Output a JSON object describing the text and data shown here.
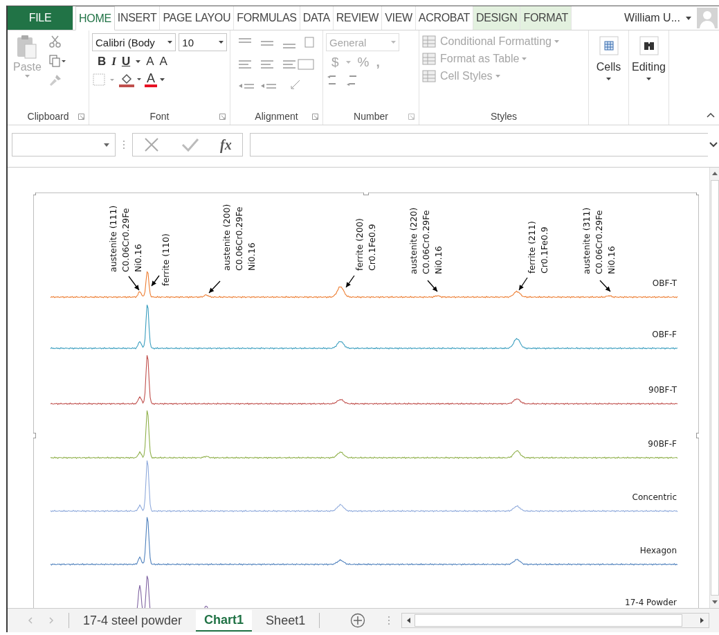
{
  "ribbon_tabs": [
    {
      "label": "FILE",
      "kind": "file",
      "selected": false
    },
    {
      "label": "HOME",
      "kind": "normal",
      "selected": true
    },
    {
      "label": "INSERT",
      "kind": "normal",
      "selected": false
    },
    {
      "label": "PAGE LAYOU",
      "kind": "normal",
      "selected": false
    },
    {
      "label": "FORMULAS",
      "kind": "normal",
      "selected": false
    },
    {
      "label": "DATA",
      "kind": "normal",
      "selected": false
    },
    {
      "label": "REVIEW",
      "kind": "normal",
      "selected": false
    },
    {
      "label": "VIEW",
      "kind": "normal",
      "selected": false
    },
    {
      "label": "ACROBAT",
      "kind": "normal",
      "selected": false
    },
    {
      "label": "DESIGN",
      "kind": "contextual",
      "selected": false
    },
    {
      "label": "FORMAT",
      "kind": "contextual",
      "selected": false
    }
  ],
  "user": {
    "name": "William U..."
  },
  "clipboard": {
    "label": "Clipboard",
    "paste": "Paste",
    "disabled": true
  },
  "font": {
    "label": "Font",
    "font_name": "Calibri (Body",
    "font_size": "10",
    "bold": "B",
    "italic": "I",
    "underline": "U",
    "grow": "A",
    "shrink": "A",
    "color_letter": "A"
  },
  "alignment": {
    "label": "Alignment"
  },
  "number": {
    "label": "Number",
    "format": "General",
    "currency": "$",
    "percent": "%",
    "comma": ",",
    "disabled": true
  },
  "styles": {
    "label": "Styles",
    "disabled": true,
    "items": [
      {
        "label": "Conditional Formatting"
      },
      {
        "label": "Format as Table"
      },
      {
        "label": "Cell Styles"
      }
    ]
  },
  "cells": {
    "label": "Cells"
  },
  "editing": {
    "label": "Editing"
  },
  "formula_bar": {
    "function_label": "fx"
  },
  "chart": {
    "annotations": [
      {
        "lines": [
          "austenite (111)",
          "C0.06Cr0.29Fe",
          "Ni0.16"
        ]
      },
      {
        "lines": [
          "ferrite (110)"
        ]
      },
      {
        "lines": [
          "austenite (200)",
          "C0.06Cr0.29Fe",
          "Ni0.16"
        ]
      },
      {
        "lines": [
          "ferrite (200)",
          "Cr0.1Fe0.9"
        ]
      },
      {
        "lines": [
          "austenite (220)",
          "C0.06Cr0.29Fe",
          "Ni0.16"
        ]
      },
      {
        "lines": [
          "ferrite (211)",
          "Cr0.1Fe0.9"
        ]
      },
      {
        "lines": [
          "austenite (311)",
          "C0.06Cr0.29Fe",
          "Ni0.16"
        ]
      }
    ],
    "traces": [
      {
        "label": "OBF-T",
        "color": "#ed7d31"
      },
      {
        "label": "OBF-F",
        "color": "#3a9ebf"
      },
      {
        "label": "90BF-T",
        "color": "#c0504d"
      },
      {
        "label": "90BF-F",
        "color": "#8fb04a"
      },
      {
        "label": "Concentric",
        "color": "#8faadc"
      },
      {
        "label": "Hexagon",
        "color": "#4f81bd"
      },
      {
        "label": "17-4 Powder",
        "color": "#8064a2"
      }
    ]
  },
  "sheet_tabs": [
    {
      "label": "17-4 steel powder",
      "selected": false
    },
    {
      "label": "Chart1",
      "selected": true
    },
    {
      "label": "Sheet1",
      "selected": false
    }
  ]
}
